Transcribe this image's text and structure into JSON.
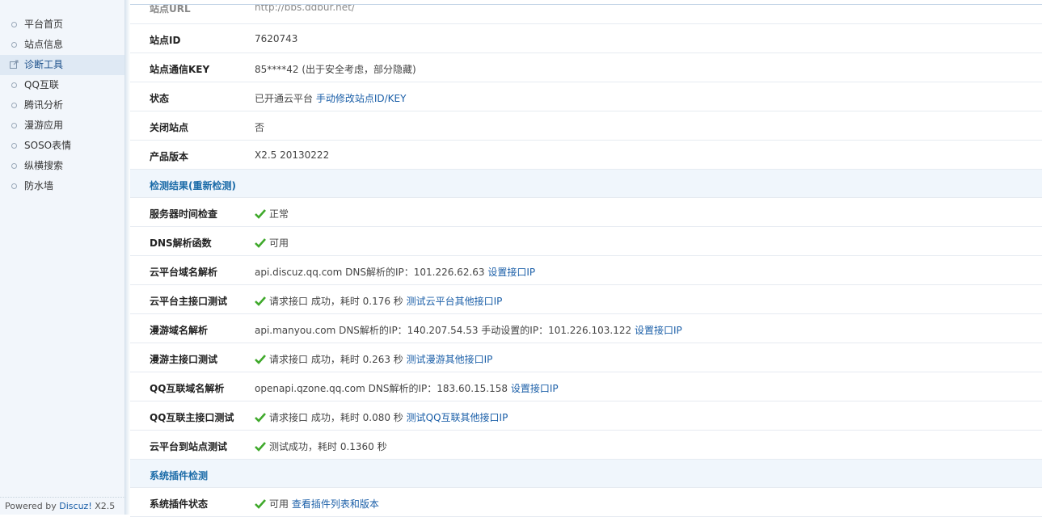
{
  "sidebar": {
    "items": [
      {
        "label": "平台首页"
      },
      {
        "label": "站点信息"
      },
      {
        "label": "诊断工具"
      },
      {
        "label": "QQ互联"
      },
      {
        "label": "腾讯分析"
      },
      {
        "label": "漫游应用"
      },
      {
        "label": "SOSO表情"
      },
      {
        "label": "纵横搜索"
      },
      {
        "label": "防水墙"
      }
    ],
    "active_index": 2,
    "powered_prefix": "Powered by",
    "powered_brand": "Discuz!",
    "powered_version": "X2.5"
  },
  "colors": {
    "accent": "#1b5fa8",
    "section_text": "#1b6ba8",
    "check_green": "#3fa92b"
  },
  "rows": {
    "partial": {
      "label": "站点URL",
      "value": "http://bbs.ddbur.net/"
    },
    "site_id": {
      "label": "站点ID",
      "value": "7620743"
    },
    "site_key": {
      "label": "站点通信KEY",
      "value": "85****42 (出于安全考虑，部分隐藏)"
    },
    "status": {
      "label": "状态",
      "value": "已开通云平台",
      "link": "手动修改站点ID/KEY"
    },
    "closed": {
      "label": "关闭站点",
      "value": "否"
    },
    "version": {
      "label": "产品版本",
      "value": "X2.5 20130222"
    },
    "section_detect": {
      "label": "检测结果(重新检测)"
    },
    "server_time": {
      "label": "服务器时间检查",
      "value": "正常"
    },
    "dns_func": {
      "label": "DNS解析函数",
      "value": "可用"
    },
    "cloud_dns": {
      "label": "云平台域名解析",
      "value": "api.discuz.qq.com DNS解析的IP：101.226.62.63",
      "link": "设置接口IP"
    },
    "cloud_api": {
      "label": "云平台主接口测试",
      "value": "请求接口 成功，耗时 0.176 秒",
      "link": "测试云平台其他接口IP"
    },
    "manyou_dns": {
      "label": "漫游域名解析",
      "value": "api.manyou.com DNS解析的IP：140.207.54.53 手动设置的IP：101.226.103.122",
      "link": "设置接口IP"
    },
    "manyou_api": {
      "label": "漫游主接口测试",
      "value": "请求接口 成功，耗时 0.263 秒",
      "link": "测试漫游其他接口IP"
    },
    "qq_dns": {
      "label": "QQ互联域名解析",
      "value": "openapi.qzone.qq.com DNS解析的IP：183.60.15.158",
      "link": "设置接口IP"
    },
    "qq_api": {
      "label": "QQ互联主接口测试",
      "value": "请求接口 成功，耗时 0.080 秒",
      "link": "测试QQ互联其他接口IP"
    },
    "cloud_site": {
      "label": "云平台到站点测试",
      "value": "测试成功，耗时 0.1360 秒"
    },
    "section_plugin": {
      "label": "系统插件检测"
    },
    "plugin_status": {
      "label": "系统插件状态",
      "value": "可用",
      "link": "查看插件列表和版本"
    }
  }
}
